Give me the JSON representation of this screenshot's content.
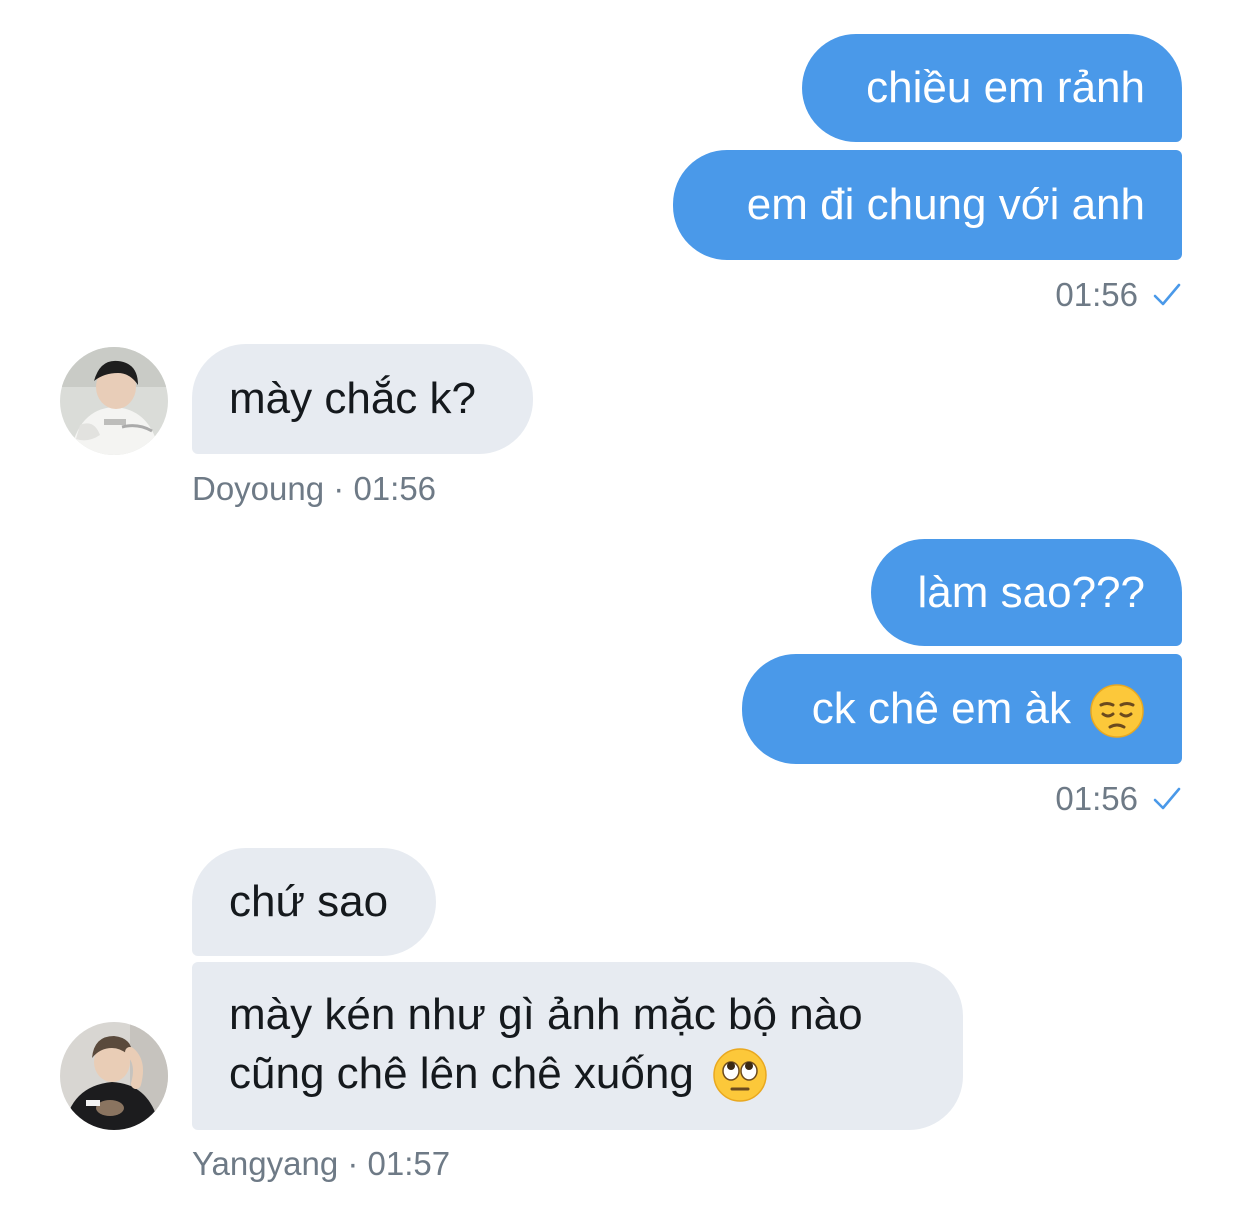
{
  "conversation": {
    "group1": {
      "msg1": "chiều em rảnh",
      "msg2": "em đi chung với anh",
      "time": "01:56"
    },
    "group2": {
      "msg1": "mày chắc k?",
      "sender": "Doyoung",
      "sep": "·",
      "time": "01:56"
    },
    "group3": {
      "msg1": "làm sao???",
      "msg2": "ck chê em àk",
      "msg2_emoji": "pensive-face",
      "time": "01:56"
    },
    "group4": {
      "msg1": "chứ sao",
      "msg2_line1": "mày kén như gì ảnh mặc bộ nào",
      "msg2_line2": "cũng chê lên chê xuống",
      "msg2_emoji": "eye-roll-face",
      "sender": "Yangyang",
      "sep": "·",
      "time": "01:57"
    }
  },
  "colors": {
    "outgoing_bubble": "#4a99e9",
    "incoming_bubble": "#e7ebf1",
    "meta_text": "#6e7a86",
    "read_check": "#4a99e9"
  }
}
